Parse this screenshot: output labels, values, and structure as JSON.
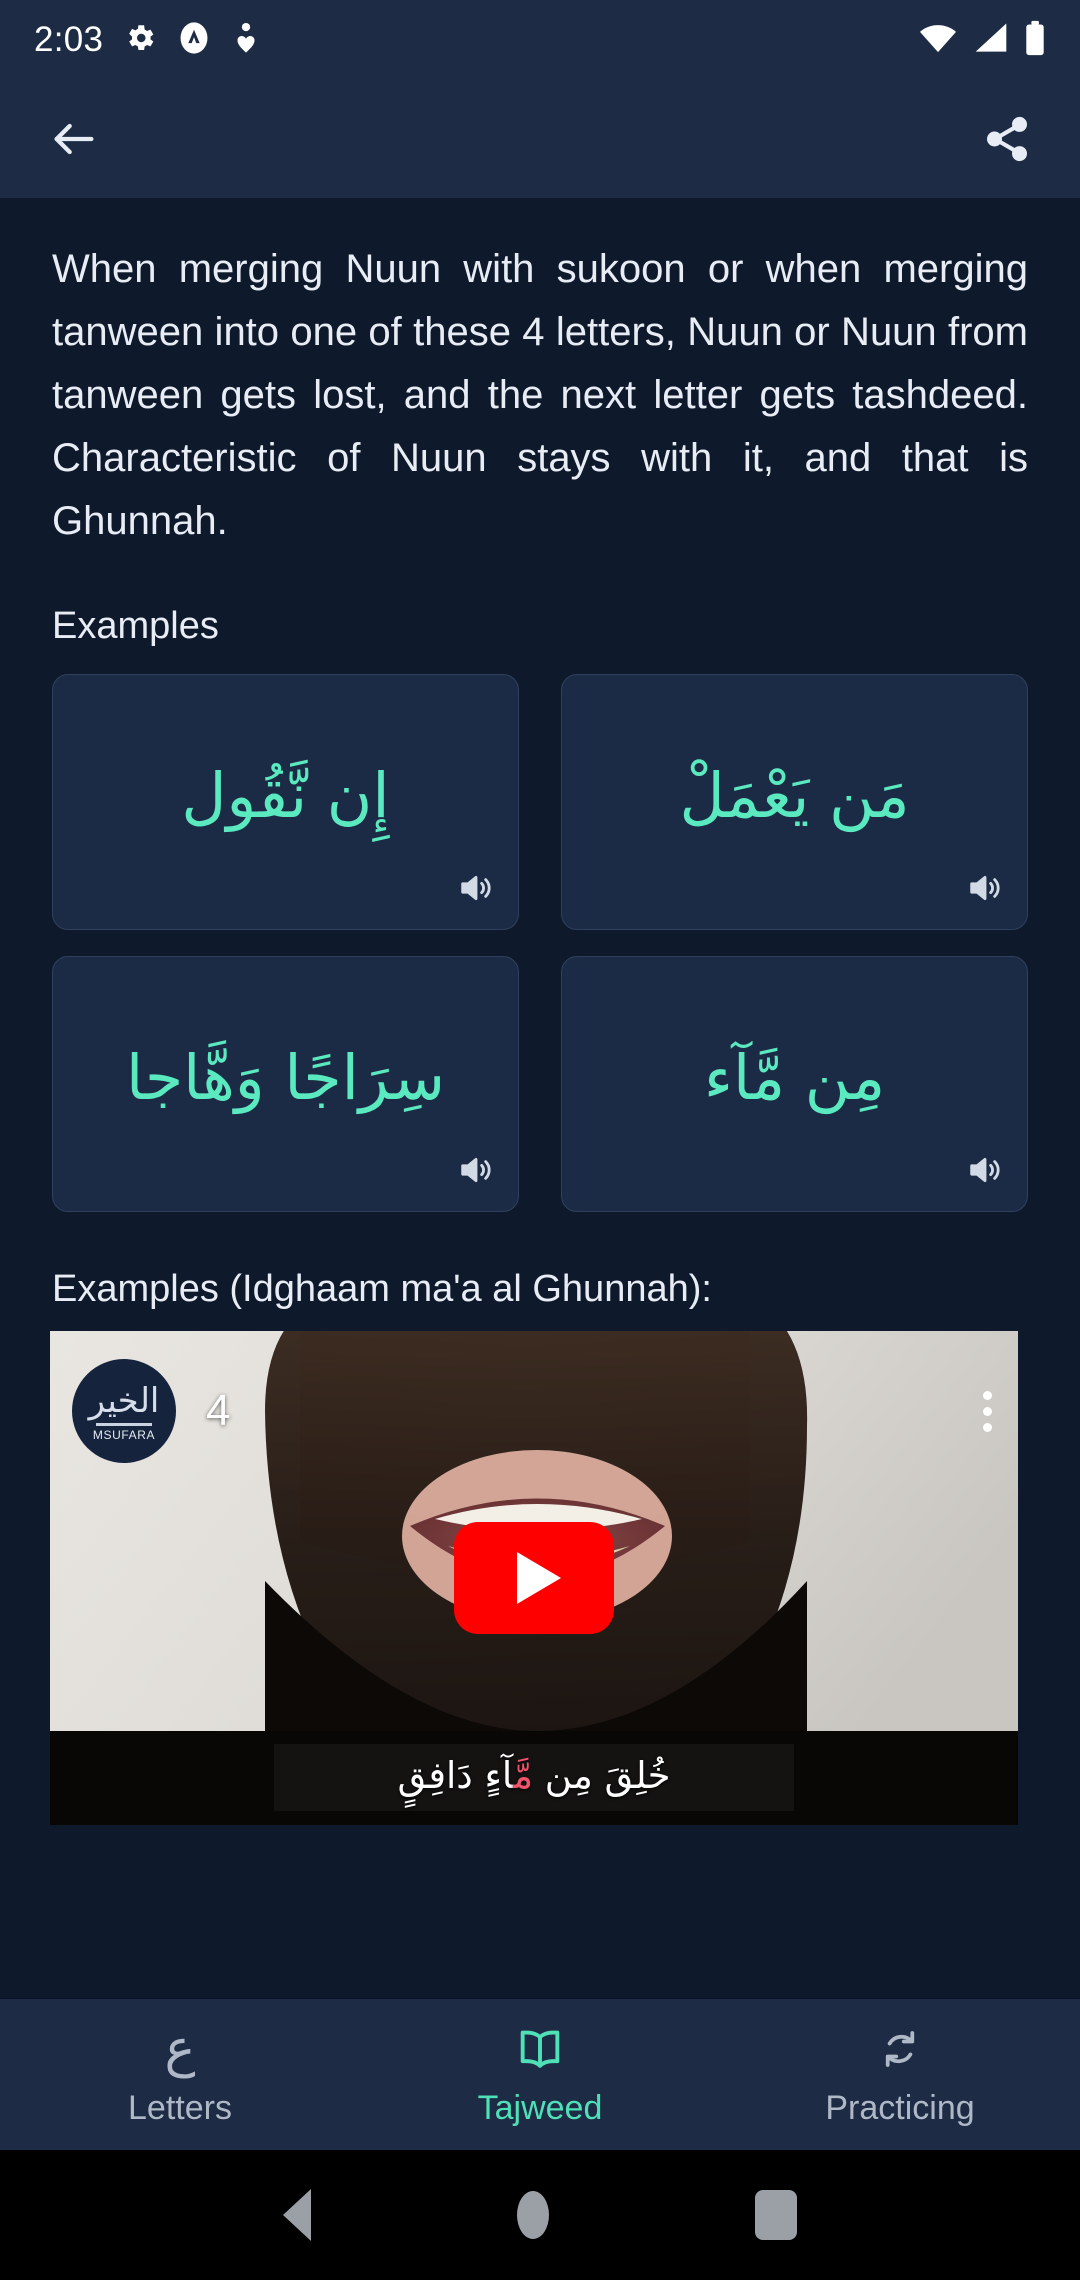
{
  "statusbar": {
    "time": "2:03",
    "icons": [
      "gear-icon",
      "app-badge-icon",
      "location-heart-icon",
      "wifi-icon",
      "cellular-signal-icon",
      "battery-icon"
    ]
  },
  "appbar": {
    "back_label": "back-arrow-icon",
    "share_label": "share-icon"
  },
  "theme": {
    "page_bg": "#0E1A2B",
    "bar_bg": "#1D2B45",
    "card_bg": "#1C2B45",
    "card_border": "#30405C",
    "accent_teal": "#5BE9C0",
    "text_primary": "#E8EDF5",
    "text_muted": "#AEB8C7",
    "youtube_red": "#FF0000",
    "caption_highlight": "#F0536B"
  },
  "main": {
    "paragraph": "When merging Nuun with sukoon or when merging tanween into one of these 4 letters, Nuun or Nuun from tanween gets lost, and the next letter gets tashdeed. Characteristic of Nuun stays with it, and that is Ghunnah.",
    "examples_heading": "Examples",
    "examples": [
      {
        "arabic": "إِن نَّقُول",
        "audio_icon": "speaker-icon"
      },
      {
        "arabic": "مَن يَعْمَلْ",
        "audio_icon": "speaker-icon"
      },
      {
        "arabic": "سِرَاجًا وَهَّاجا",
        "audio_icon": "speaker-icon"
      },
      {
        "arabic": "مِن مَّآء",
        "audio_icon": "speaker-icon"
      }
    ],
    "video_heading": "Examples (Idghaam ma'a al Ghunnah):",
    "video": {
      "title": "4",
      "channel_calligraphy": "الخير",
      "channel_name": "MSUFARA",
      "menu_icon": "more-vertical-icon",
      "play_icon": "youtube-play-icon",
      "caption_before": "خُلِقَ مِن ",
      "caption_highlight": "مَّ",
      "caption_after": "آءٍ دَافِقٍ"
    }
  },
  "bottomnav": {
    "items": [
      {
        "label": "Letters",
        "icon": "arabic-ain-icon",
        "glyph": "ع",
        "active": false
      },
      {
        "label": "Tajweed",
        "icon": "open-book-icon",
        "glyph": "",
        "active": true
      },
      {
        "label": "Practicing",
        "icon": "refresh-icon",
        "glyph": "",
        "active": false
      }
    ]
  },
  "androidnav": {
    "back": "android-back-button",
    "home": "android-home-button",
    "recents": "android-recents-button"
  }
}
